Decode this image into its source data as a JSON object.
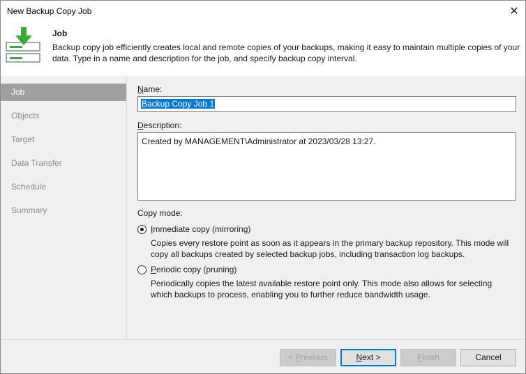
{
  "window": {
    "title": "New Backup Copy Job",
    "close_glyph": "✕"
  },
  "header": {
    "title": "Job",
    "description": "Backup copy job efficiently creates local and remote copies of your backups, making it easy to maintain multiple copies of your data. Type in a name and description for the job, and specify backup copy interval.",
    "icon": "backup-copy-icon"
  },
  "sidebar": {
    "items": [
      {
        "label": "Job",
        "active": true
      },
      {
        "label": "Objects",
        "active": false
      },
      {
        "label": "Target",
        "active": false
      },
      {
        "label": "Data Transfer",
        "active": false
      },
      {
        "label": "Schedule",
        "active": false
      },
      {
        "label": "Summary",
        "active": false
      }
    ]
  },
  "form": {
    "name_label_first": "N",
    "name_label_rest": "ame:",
    "name_value": "Backup Copy Job 1",
    "description_label_first": "D",
    "description_label_rest": "escription:",
    "description_value": "Created by MANAGEMENT\\Administrator at 2023/03/28 13:27.",
    "copy_mode_label": "Copy mode:",
    "modes": [
      {
        "label_first": "I",
        "label_rest": "mmediate copy (mirroring)",
        "checked": true,
        "description": "Copies every restore point as soon as it appears in the primary backup repository. This mode will copy all backups created by selected backup jobs, including transaction log backups."
      },
      {
        "label_first": "P",
        "label_rest": "eriodic copy (pruning)",
        "checked": false,
        "description": "Periodically copies the latest available restore point only. This mode also allows for selecting which backups to process, enabling you to further reduce bandwidth usage."
      }
    ]
  },
  "footer": {
    "previous_prefix": "< ",
    "previous_first": "P",
    "previous_rest": "revious",
    "next_first": "N",
    "next_rest": "ext >",
    "finish_first": "F",
    "finish_rest": "inish",
    "cancel": "Cancel"
  },
  "colors": {
    "accent": "#0078d7",
    "sidebar_active": "#a0a0a0",
    "panel": "#f0f0f0",
    "icon_green": "#3aa935"
  }
}
